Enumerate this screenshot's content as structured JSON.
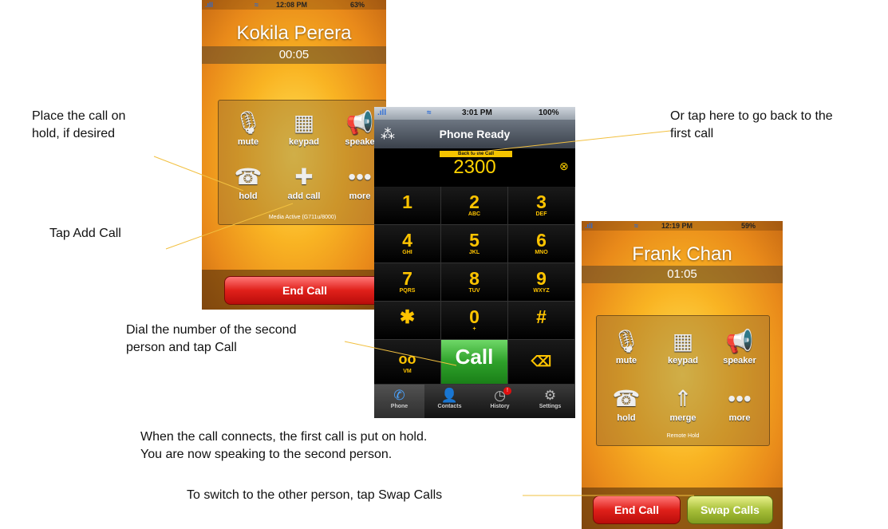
{
  "annotations": {
    "hold": [
      "Place the call on",
      "hold, if desired"
    ],
    "add_call": "Tap Add Call",
    "back_to_first": [
      "Or tap here to go back to the",
      "first call"
    ],
    "dial": [
      "Dial the number of the second",
      "person and tap Call"
    ],
    "connected": [
      "When the call connects, the first call is put on hold.",
      "You are now speaking to the second person."
    ],
    "swap": "To switch to the other person, tap Swap Calls"
  },
  "phone1": {
    "status": {
      "time": "12:08 PM",
      "battery": "63%"
    },
    "caller": "Kokila Perera",
    "timer": "00:05",
    "buttons": [
      {
        "label": "mute",
        "icon": "microphone-mute-icon"
      },
      {
        "label": "keypad",
        "icon": "keypad-icon"
      },
      {
        "label": "speake",
        "icon": "speaker-icon"
      },
      {
        "label": "hold",
        "icon": "hold-icon"
      },
      {
        "label": "add call",
        "icon": "plus-icon"
      },
      {
        "label": "more",
        "icon": "ellipsis-icon"
      }
    ],
    "media_status": "Media Active (G711u/8000)",
    "end_call": "End Call"
  },
  "dialer": {
    "status": {
      "time": "3:01 PM",
      "battery": "100%"
    },
    "title": "Phone Ready",
    "back_to_call": "Back to the Call",
    "number": "2300",
    "keys": [
      {
        "digit": "1",
        "letters": ""
      },
      {
        "digit": "2",
        "letters": "ABC"
      },
      {
        "digit": "3",
        "letters": "DEF"
      },
      {
        "digit": "4",
        "letters": "GHI"
      },
      {
        "digit": "5",
        "letters": "JKL"
      },
      {
        "digit": "6",
        "letters": "MNO"
      },
      {
        "digit": "7",
        "letters": "PQRS"
      },
      {
        "digit": "8",
        "letters": "TUV"
      },
      {
        "digit": "9",
        "letters": "WXYZ"
      },
      {
        "digit": "✱",
        "letters": ""
      },
      {
        "digit": "0",
        "letters": "+"
      },
      {
        "digit": "#",
        "letters": ""
      }
    ],
    "vm_label": "VM",
    "call_label": "Call",
    "tabs": [
      {
        "label": "Phone",
        "icon": "phone-icon"
      },
      {
        "label": "Contacts",
        "icon": "contacts-icon"
      },
      {
        "label": "History",
        "icon": "history-icon"
      },
      {
        "label": "Settings",
        "icon": "settings-icon"
      }
    ],
    "history_badge": "!"
  },
  "phone2": {
    "status": {
      "time": "12:19 PM",
      "battery": "59%"
    },
    "caller": "Frank Chan",
    "timer": "01:05",
    "buttons": [
      {
        "label": "mute",
        "icon": "microphone-mute-icon"
      },
      {
        "label": "keypad",
        "icon": "keypad-icon"
      },
      {
        "label": "speaker",
        "icon": "speaker-icon"
      },
      {
        "label": "hold",
        "icon": "hold-icon"
      },
      {
        "label": "merge",
        "icon": "merge-icon"
      },
      {
        "label": "more",
        "icon": "ellipsis-icon"
      }
    ],
    "hold_status": "Remote Hold",
    "end_call": "End Call",
    "swap_calls": "Swap Calls"
  }
}
